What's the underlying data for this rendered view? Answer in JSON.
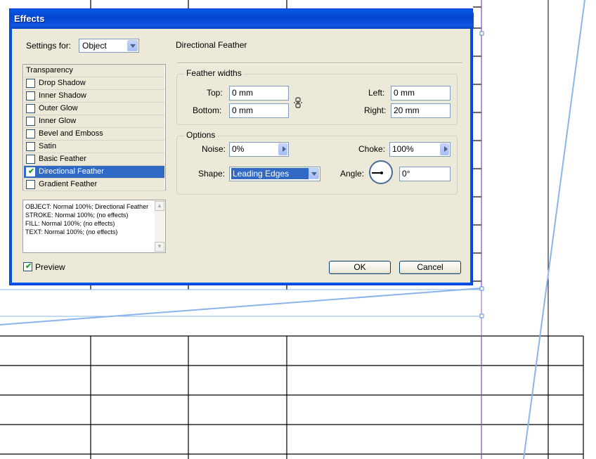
{
  "dialog": {
    "title": "Effects",
    "settings_for_label": "Settings for:",
    "settings_for_value": "Object",
    "effects_list": [
      {
        "label": "Transparency",
        "has_checkbox": false,
        "checked": false,
        "selected": false
      },
      {
        "label": "Drop Shadow",
        "has_checkbox": true,
        "checked": false,
        "selected": false
      },
      {
        "label": "Inner Shadow",
        "has_checkbox": true,
        "checked": false,
        "selected": false
      },
      {
        "label": "Outer Glow",
        "has_checkbox": true,
        "checked": false,
        "selected": false
      },
      {
        "label": "Inner Glow",
        "has_checkbox": true,
        "checked": false,
        "selected": false
      },
      {
        "label": "Bevel and Emboss",
        "has_checkbox": true,
        "checked": false,
        "selected": false
      },
      {
        "label": "Satin",
        "has_checkbox": true,
        "checked": false,
        "selected": false
      },
      {
        "label": "Basic Feather",
        "has_checkbox": true,
        "checked": false,
        "selected": false
      },
      {
        "label": "Directional Feather",
        "has_checkbox": true,
        "checked": true,
        "selected": true
      },
      {
        "label": "Gradient Feather",
        "has_checkbox": true,
        "checked": false,
        "selected": false
      }
    ],
    "summary_text": "OBJECT: Normal 100%; Directional Feather\nSTROKE: Normal 100%; (no effects)\nFILL: Normal 100%; (no effects)\nTEXT: Normal 100%; (no effects)",
    "section_title": "Directional Feather",
    "feather_widths": {
      "group_title": "Feather widths",
      "top_label": "Top:",
      "top_value": "0 mm",
      "bottom_label": "Bottom:",
      "bottom_value": "0 mm",
      "left_label": "Left:",
      "left_value": "0 mm",
      "right_label": "Right:",
      "right_value": "20 mm"
    },
    "options": {
      "group_title": "Options",
      "noise_label": "Noise:",
      "noise_value": "0%",
      "choke_label": "Choke:",
      "choke_value": "100%",
      "shape_label": "Shape:",
      "shape_value": "Leading Edges",
      "angle_label": "Angle:",
      "angle_value": "0°"
    },
    "preview_label": "Preview",
    "preview_checked": true,
    "ok_label": "OK",
    "cancel_label": "Cancel"
  },
  "colors": {
    "title_bar": "#0a5ae8",
    "dialog_bg": "#ece9d8",
    "selection": "#316ac5",
    "feather_line": "#8ab4ea",
    "guide_line": "#9a5fc8"
  }
}
